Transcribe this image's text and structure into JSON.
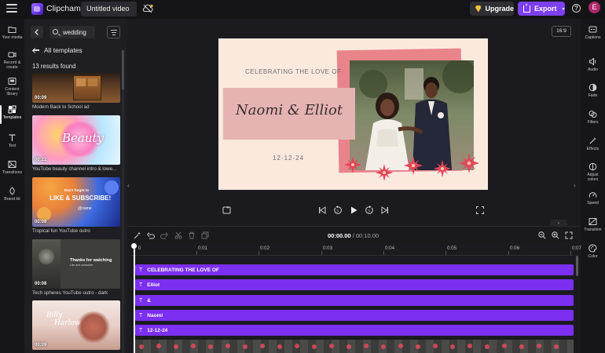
{
  "app": {
    "brand": "Clipchamp",
    "video_title": "Untitled video",
    "upgrade_label": "Upgrade",
    "export_label": "Export",
    "avatar_initial": "E",
    "help_label": "?",
    "accent": "#7c3ff2"
  },
  "left_rail": {
    "items": [
      {
        "label_1": "Your media",
        "label_2": "",
        "icon": "folder-icon"
      },
      {
        "label_1": "Record &",
        "label_2": "create",
        "icon": "video-camera-icon"
      },
      {
        "label_1": "Content",
        "label_2": "library",
        "icon": "library-icon"
      },
      {
        "label_1": "Templates",
        "label_2": "",
        "icon": "templates-icon"
      },
      {
        "label_1": "Text",
        "label_2": "",
        "icon": "text-icon"
      },
      {
        "label_1": "Transitions",
        "label_2": "",
        "icon": "transitions-icon"
      },
      {
        "label_1": "Brand kit",
        "label_2": "",
        "icon": "brand-kit-icon"
      }
    ]
  },
  "panel": {
    "search_value": "wedding",
    "all_templates": "All templates",
    "results": "13 results found",
    "templates": [
      {
        "duration": "00:09",
        "caption": "Modern Back to School ad"
      },
      {
        "duration": "00:22",
        "caption": "YouTube beauty channel intro & lowe...",
        "thumb_text": "Beauty"
      },
      {
        "duration": "00:08",
        "caption": "Tropical fun YouTube outro",
        "thumb_text_1": "Don't forget to",
        "thumb_text_2": "LIKE & SUBSCRIBE!",
        "thumb_handle": "@name"
      },
      {
        "duration": "00:08",
        "caption": "Tech spheres YouTube outro - dark",
        "thumb_text_1": "Thanks for watching",
        "thumb_text_2": "Like and subscribe"
      },
      {
        "duration": "00:09",
        "caption": "",
        "thumb_text_1": "Billy",
        "thumb_text_2": "Harlow"
      }
    ]
  },
  "right_rail": {
    "items": [
      {
        "label": "Captions",
        "icon": "captions-icon"
      },
      {
        "label": "Audio",
        "icon": "audio-icon"
      },
      {
        "label": "Fade",
        "icon": "fade-icon"
      },
      {
        "label": "Filters",
        "icon": "filters-icon"
      },
      {
        "label": "Effects",
        "icon": "effects-icon"
      },
      {
        "label_1": "Adjust",
        "label_2": "colors",
        "icon": "adjust-colors-icon"
      },
      {
        "label": "Speed",
        "icon": "speed-icon"
      },
      {
        "label": "Transition",
        "icon": "transition-icon"
      },
      {
        "label": "Color",
        "icon": "color-icon"
      }
    ]
  },
  "stage": {
    "aspect_ratio": "16:9",
    "headline": "CELEBRATING THE LOVE OF",
    "names": "Naomi & Elliot",
    "date": "12-12-24"
  },
  "timeline": {
    "current_time": "00:00.00",
    "total_time": "/ 00:10.00",
    "ticks": [
      "0",
      "0:01",
      "0:02",
      "0:03",
      "0:04",
      "0:05",
      "0:06",
      "0:07"
    ],
    "tracks": [
      "CELEBRATING THE LOVE OF",
      "Elliot",
      "&",
      "Naomi",
      "12-12-24"
    ],
    "track_icon": "T"
  }
}
